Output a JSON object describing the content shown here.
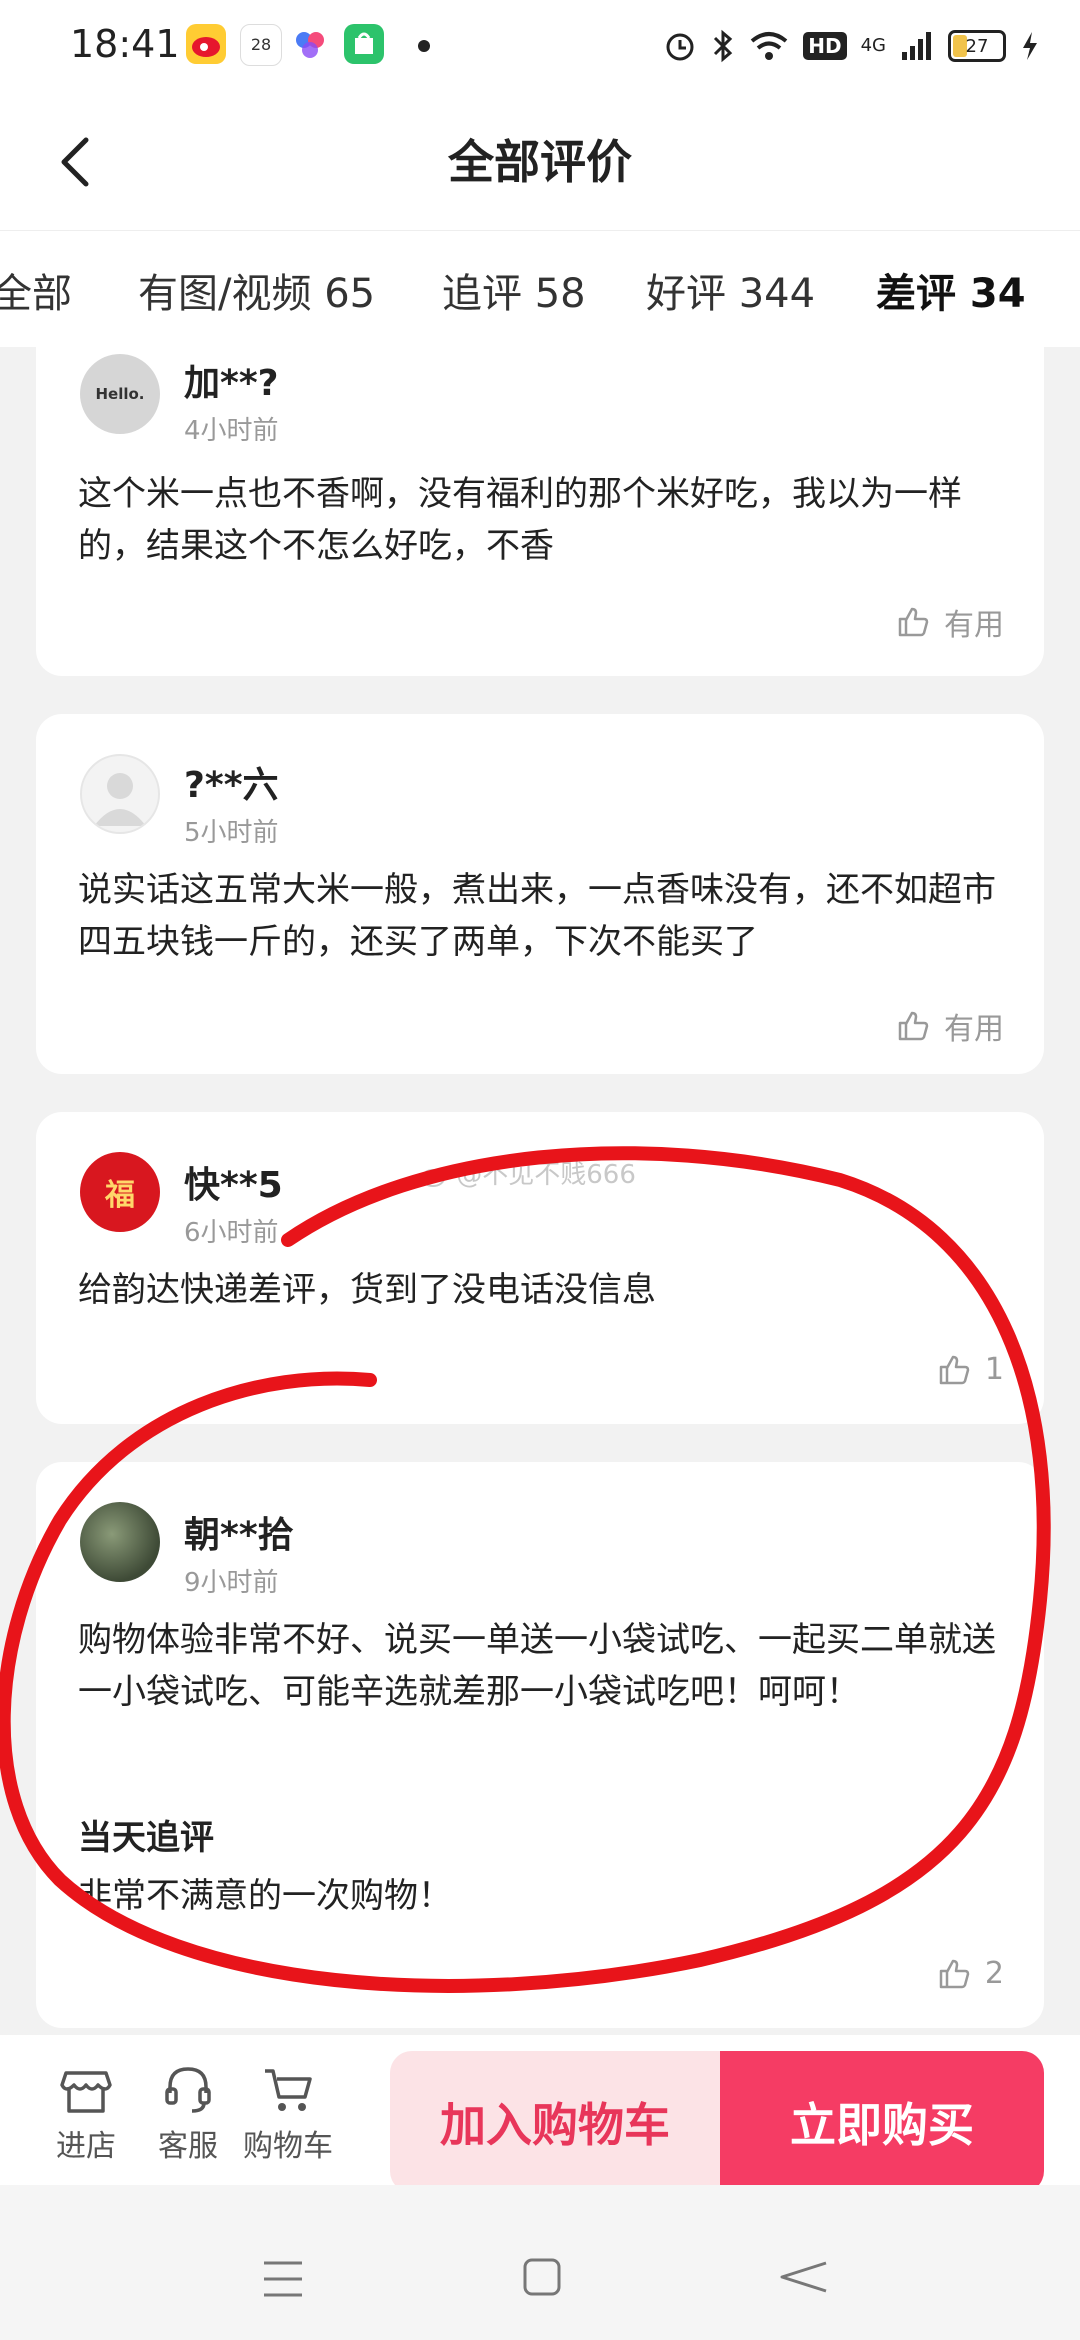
{
  "status_bar": {
    "time": "18:41",
    "calendar_day": "28",
    "hd_label": "HD",
    "network": "4G",
    "battery": "27"
  },
  "header": {
    "title": "全部评价"
  },
  "tabs": [
    {
      "label": "全部"
    },
    {
      "label": "有图/视频 65"
    },
    {
      "label": "追评 58"
    },
    {
      "label": "好评 344"
    },
    {
      "label": "差评 34"
    }
  ],
  "reviews": [
    {
      "username": "加**?",
      "time": "4小时前",
      "avatar_text": "Hello.",
      "text": "这个米一点也不香啊，没有福利的那个米好吃，我以为一样的，结果这个不怎么好吃，不香",
      "like_label": "有用"
    },
    {
      "username": "?**六",
      "time": "5小时前",
      "text": "说实话这五常大米一般，煮出来，一点香味没有，还不如超市四五块钱一斤的，还买了两单，下次不能买了",
      "like_label": "有用"
    },
    {
      "username": "快**5",
      "time": "6小时前",
      "avatar_text": "福",
      "text": "给韵达快递差评，货到了没电话没信息",
      "like_label": "1"
    },
    {
      "username": "朝**拾",
      "time": "9小时前",
      "text": "购物体验非常不好、说买一单送一小袋试吃、一起买二单就送一小袋试吃、可能辛选就差那一小袋试吃吧！呵呵！",
      "followup_title": "当天追评",
      "followup_text": "非常不满意的一次购物！",
      "like_label": "2"
    }
  ],
  "watermark": "@不见不贱666",
  "bottom_bar": {
    "store_label": "进店",
    "service_label": "客服",
    "cart_label": "购物车",
    "add_to_cart": "加入购物车",
    "buy_now": "立即购买"
  },
  "colors": {
    "accent": "#f53c64",
    "accent_light": "#fce3e6",
    "annotation": "#e8141a"
  }
}
